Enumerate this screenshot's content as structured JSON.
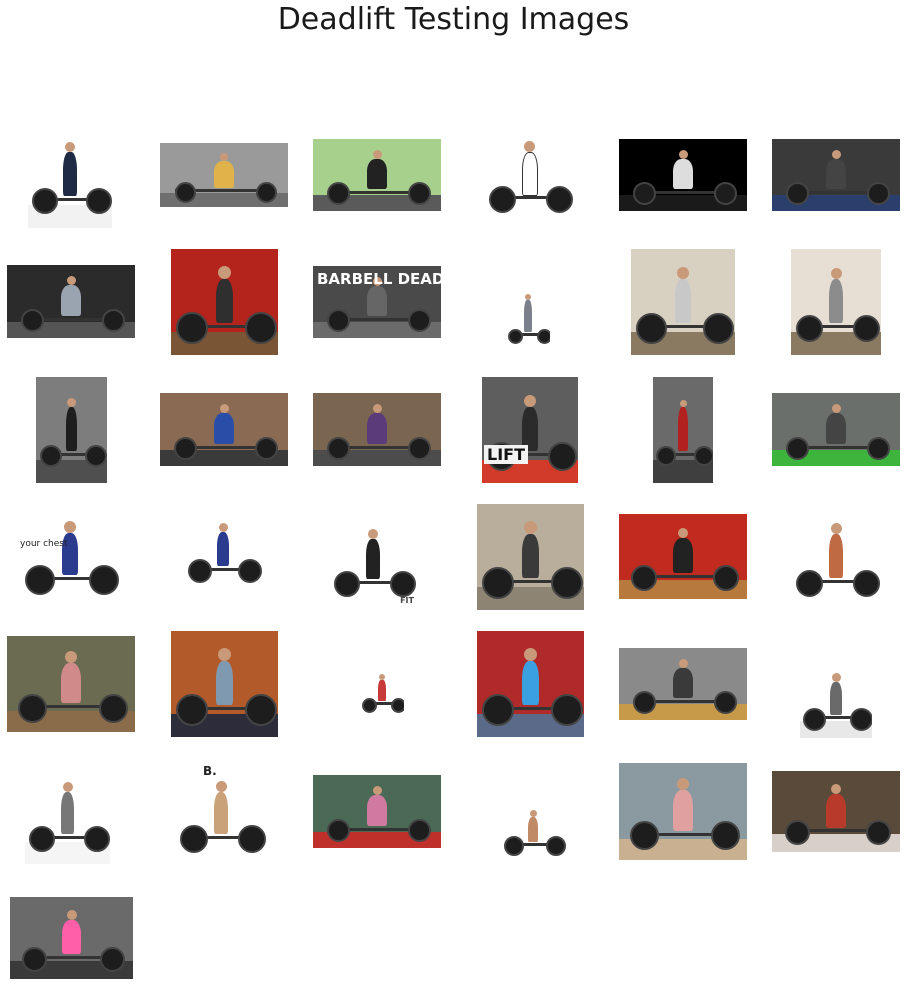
{
  "title": "Deadlift Testing Images",
  "images": [
    {
      "bg": "#ffffff",
      "floor": "#f2f2f2",
      "shirt": "#1f2a44",
      "text": ""
    },
    {
      "bg": "#9a9a9a",
      "floor": "#6f6f6f",
      "shirt": "#e0b34a",
      "text": ""
    },
    {
      "bg": "#a8d08d",
      "floor": "#5a5a5a",
      "shirt": "#222222",
      "text": ""
    },
    {
      "bg": "#ffffff",
      "floor": "#ffffff",
      "shirt": "#ffffff",
      "text": ""
    },
    {
      "bg": "#000000",
      "floor": "#1a1a1a",
      "shirt": "#dddddd",
      "text": ""
    },
    {
      "bg": "#3a3a3a",
      "floor": "#2a3f6b",
      "shirt": "#444444",
      "text": ""
    },
    {
      "bg": "#2b2b2b",
      "floor": "#555555",
      "shirt": "#9aa3b0",
      "text": ""
    },
    {
      "bg": "#b4231c",
      "floor": "#7a5535",
      "shirt": "#2f2f2f",
      "text": ""
    },
    {
      "bg": "#4a4a4a",
      "floor": "#6b6b6b",
      "shirt": "#666666",
      "text": "BARBELL DEADLIFT"
    },
    {
      "bg": "#ffffff",
      "floor": "#ffffff",
      "shirt": "#7a7f8c",
      "text": ""
    },
    {
      "bg": "#d8d0c0",
      "floor": "#8a7a62",
      "shirt": "#c8c8c8",
      "text": ""
    },
    {
      "bg": "#e7dfd4",
      "floor": "#8a7a62",
      "shirt": "#8c8c8c",
      "text": ""
    },
    {
      "bg": "#7d7d7d",
      "floor": "#4f4f4f",
      "shirt": "#1e1e1e",
      "text": ""
    },
    {
      "bg": "#8a6a52",
      "floor": "#3a3a3a",
      "shirt": "#2a4ea8",
      "text": ""
    },
    {
      "bg": "#7a6650",
      "floor": "#4c4c4c",
      "shirt": "#5c3b7a",
      "text": ""
    },
    {
      "bg": "#5e5e5e",
      "floor": "#d23a2a",
      "shirt": "#2b2b2b",
      "text": "LIFT"
    },
    {
      "bg": "#6a6a6a",
      "floor": "#3f3f3f",
      "shirt": "#b22020",
      "text": ""
    },
    {
      "bg": "#6b6f6b",
      "floor": "#3db53d",
      "shirt": "#444444",
      "text": ""
    },
    {
      "bg": "#ffffff",
      "floor": "#ffffff",
      "shirt": "#2b3c8f",
      "text": "your chest"
    },
    {
      "bg": "#ffffff",
      "floor": "#ffffff",
      "shirt": "#2b3c8f",
      "text": ""
    },
    {
      "bg": "#ffffff",
      "floor": "#ffffff",
      "shirt": "#222222",
      "text": "FIT"
    },
    {
      "bg": "#b9ae9c",
      "floor": "#8d8474",
      "shirt": "#3a3a3a",
      "text": ""
    },
    {
      "bg": "#c02a1f",
      "floor": "#b87a3c",
      "shirt": "#222222",
      "text": ""
    },
    {
      "bg": "#ffffff",
      "floor": "#ffffff",
      "shirt": "#c06a44",
      "text": ""
    },
    {
      "bg": "#6b6b52",
      "floor": "#8a6b4a",
      "shirt": "#d08a8a",
      "text": ""
    },
    {
      "bg": "#b35a2a",
      "floor": "#2c2c3a",
      "shirt": "#7f9ab0",
      "text": ""
    },
    {
      "bg": "#ffffff",
      "floor": "#ffffff",
      "shirt": "#c83a3a",
      "text": ""
    },
    {
      "bg": "#b02a2a",
      "floor": "#5a6a88",
      "shirt": "#3aa0e0",
      "text": ""
    },
    {
      "bg": "#8a8a8a",
      "floor": "#c79a4a",
      "shirt": "#3a3a3a",
      "text": ""
    },
    {
      "bg": "#ffffff",
      "floor": "#e8e8e8",
      "shirt": "#6a6a6a",
      "text": ""
    },
    {
      "bg": "#ffffff",
      "floor": "#f5f5f5",
      "shirt": "#777777",
      "text": ""
    },
    {
      "bg": "#ffffff",
      "floor": "#ffffff",
      "shirt": "#c9a27a",
      "text": "B."
    },
    {
      "bg": "#4a6a55",
      "floor": "#c0302a",
      "shirt": "#d07aa0",
      "text": ""
    },
    {
      "bg": "#ffffff",
      "floor": "#ffffff",
      "shirt": "#c08a66",
      "text": ""
    },
    {
      "bg": "#8a9aa0",
      "floor": "#c8b090",
      "shirt": "#e0a0a0",
      "text": ""
    },
    {
      "bg": "#5a4a3a",
      "floor": "#d8d0c8",
      "shirt": "#b83a2a",
      "text": ""
    },
    {
      "bg": "#6a6a6a",
      "floor": "#3a3a3a",
      "shirt": "#ff5fa8",
      "text": ""
    }
  ]
}
